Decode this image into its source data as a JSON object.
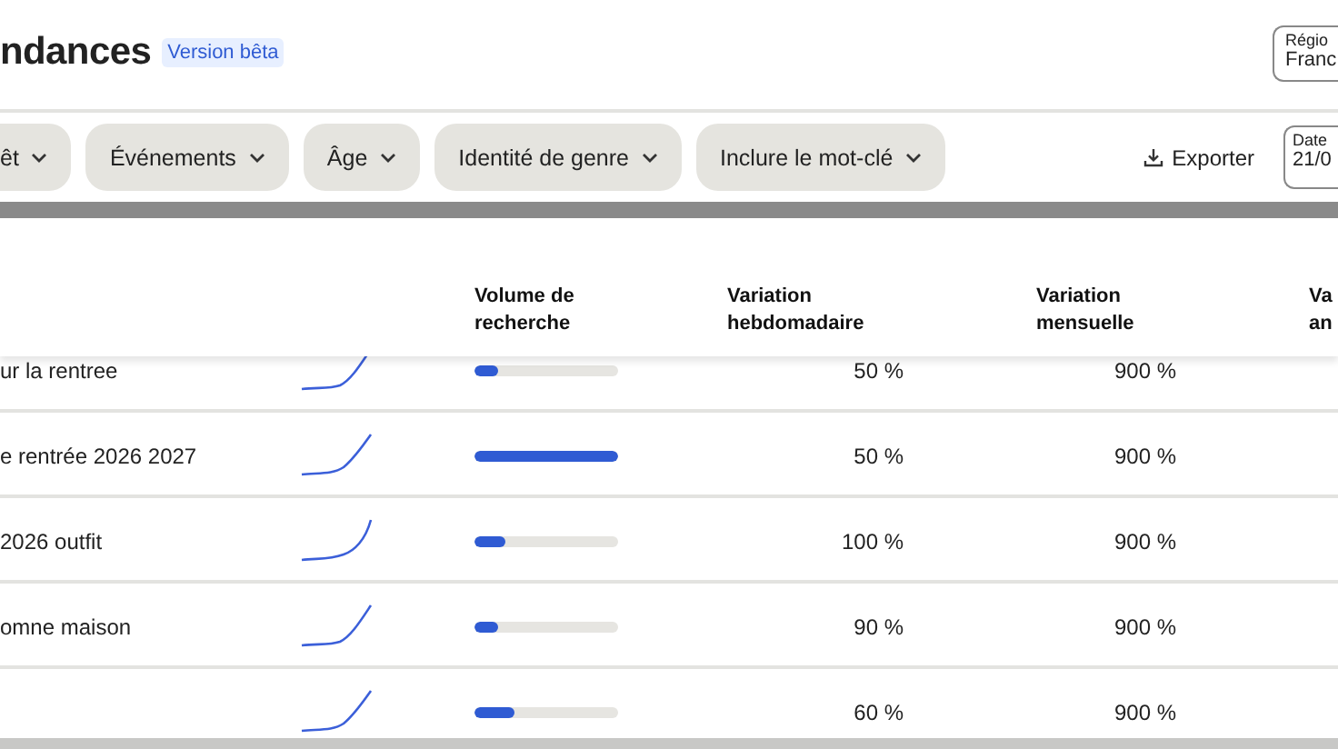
{
  "header": {
    "title": "ndances",
    "badge": "Version bêta",
    "region": {
      "label": "Régio",
      "value": "Franc"
    }
  },
  "filters": [
    {
      "label": "êt"
    },
    {
      "label": "Événements"
    },
    {
      "label": "Âge"
    },
    {
      "label": "Identité de genre"
    },
    {
      "label": "Inclure le mot-clé"
    }
  ],
  "export": "Exporter",
  "date": {
    "label": "Date",
    "value": "21/0"
  },
  "table": {
    "columns": [
      "Volume de recherche",
      "Variation hebdomadaire",
      "Variation mensuelle",
      "Va an"
    ],
    "rows": [
      {
        "keyword": "ur la rentree",
        "level": 0.17,
        "weekly": "50 %",
        "monthly": "900 %"
      },
      {
        "keyword": "e rentrée 2026 2027",
        "level": 1.0,
        "weekly": "50 %",
        "monthly": "900 %"
      },
      {
        "keyword": "2026 outfit",
        "level": 0.22,
        "weekly": "100 %",
        "monthly": "900 %"
      },
      {
        "keyword": "omne maison",
        "level": 0.16,
        "weekly": "90 %",
        "monthly": "900 %"
      },
      {
        "level": 0.28,
        "weekly": "60 %",
        "monthly": "900 %"
      }
    ]
  }
}
